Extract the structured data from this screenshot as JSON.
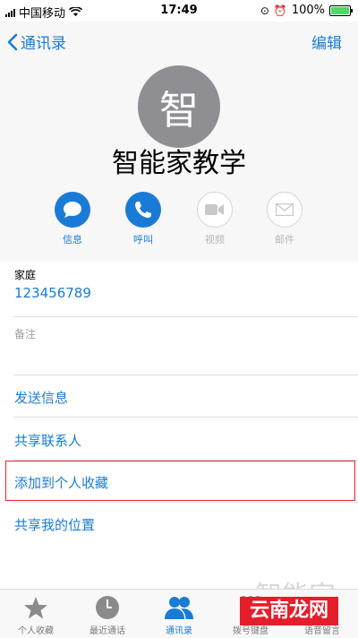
{
  "status_bar": {
    "carrier": "中国移动",
    "time": "17:49",
    "battery": "100%",
    "battery_level": 1.0
  },
  "nav": {
    "back_label": "通讯录",
    "edit_label": "编辑"
  },
  "contact": {
    "avatar_char": "智",
    "name": "智能家教学"
  },
  "actions": [
    {
      "label": "信息",
      "icon": "message-bubble-icon",
      "enabled": true
    },
    {
      "label": "呼叫",
      "icon": "phone-icon",
      "enabled": true
    },
    {
      "label": "视频",
      "icon": "video-camera-icon",
      "enabled": false
    },
    {
      "label": "邮件",
      "icon": "mail-icon",
      "enabled": false
    }
  ],
  "phone_field": {
    "label": "家庭",
    "value": "123456789"
  },
  "notes_field": {
    "label": "备注"
  },
  "menu": [
    "发送信息",
    "共享联系人",
    "添加到个人收藏",
    "共享我的位置"
  ],
  "tabs": [
    {
      "label": "个人收藏",
      "icon": "star-icon",
      "active": false
    },
    {
      "label": "最近通话",
      "icon": "clock-icon",
      "active": false
    },
    {
      "label": "通讯录",
      "icon": "contacts-icon",
      "active": true
    },
    {
      "label": "拨号键盘",
      "icon": "keypad-icon",
      "active": false
    },
    {
      "label": "语音留言",
      "icon": "voicemail-icon",
      "active": false
    }
  ],
  "watermark": {
    "text": "云南龙网",
    "ghost_text": "智能家"
  },
  "colors": {
    "accent": "#1a7bd6",
    "highlight": "#e0262b",
    "avatar": "#8e8e93"
  }
}
